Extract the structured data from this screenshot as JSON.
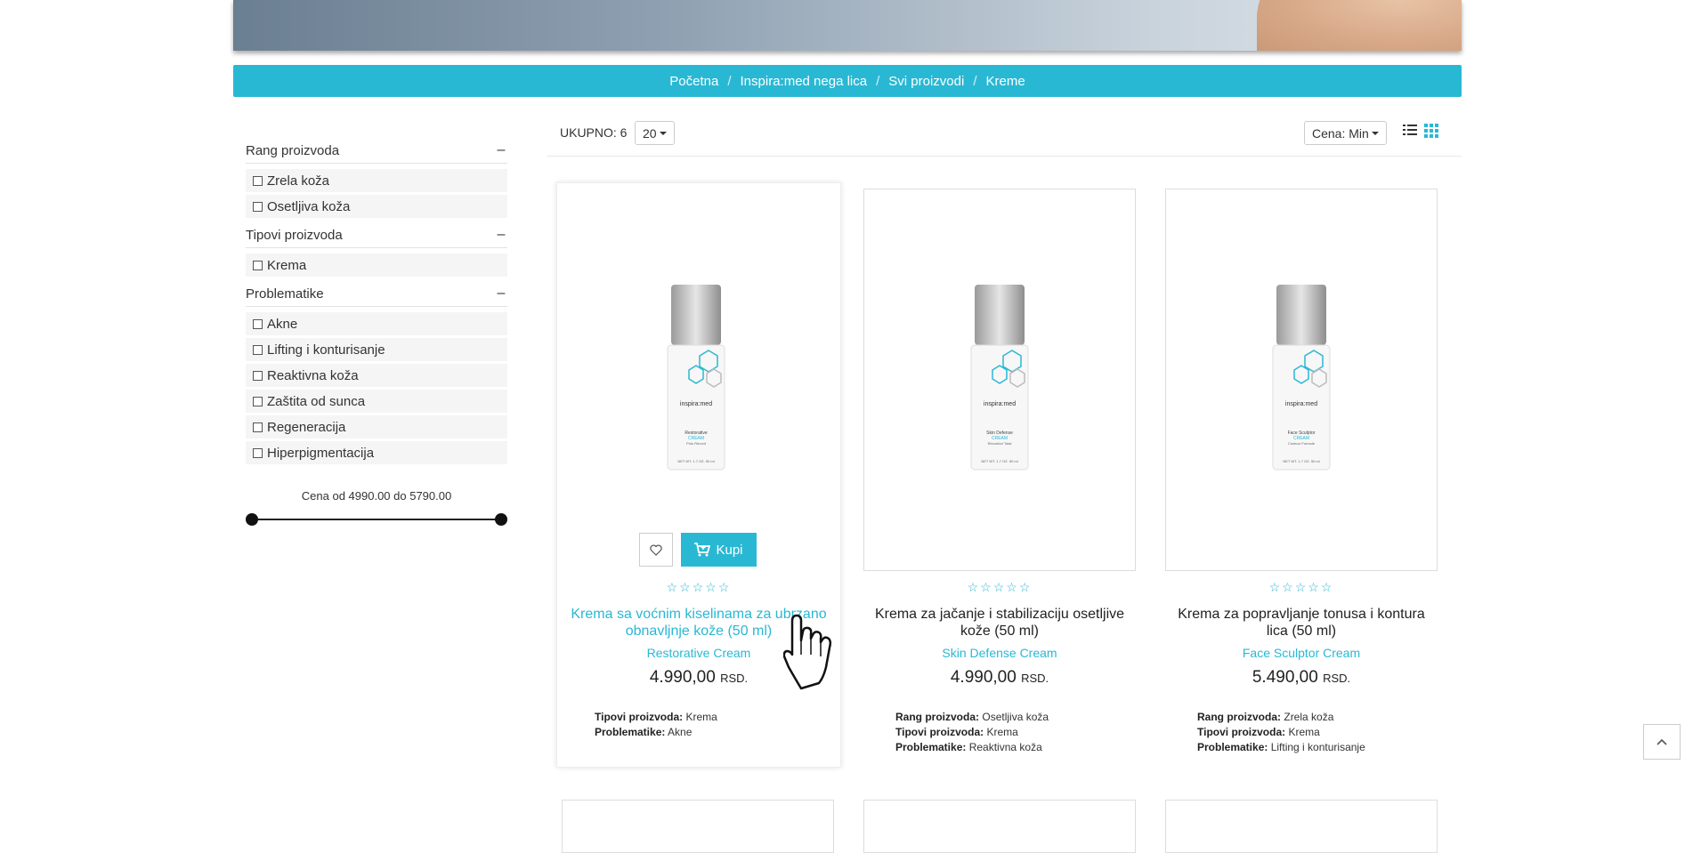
{
  "breadcrumb": [
    "Početna",
    "Inspira:med nega lica",
    "Svi proizvodi",
    "Kreme"
  ],
  "filters": [
    {
      "title": "Rang proizvoda",
      "toggle": "–",
      "options": [
        "Zrela koža",
        "Osetljiva koža"
      ]
    },
    {
      "title": "Tipovi proizvoda",
      "toggle": "–",
      "options": [
        "Krema"
      ]
    },
    {
      "title": "Problematike",
      "toggle": "–",
      "options": [
        "Akne",
        "Lifting i konturisanje",
        "Reaktivna koža",
        "Zaštita od sunca",
        "Regeneracija",
        "Hiperpigmentacija"
      ]
    }
  ],
  "price_filter": {
    "label": "Cena od 4990.00 do 5790.00",
    "min": 4990,
    "max": 5790
  },
  "toolbar": {
    "total": "UKUPNO: 6",
    "per_page": "20",
    "sort": "Cena: Min"
  },
  "buttons": {
    "buy": "Kupi"
  },
  "product_image": {
    "brand": "inspira:med",
    "size": "NET WT. 1.7 OZ.   50 ml"
  },
  "products": [
    {
      "title": "Krema sa voćnim kiselinama za ubrzano obnavljnje kože (50 ml)",
      "subtitle": "Restorative Cream",
      "price": "4.990,00",
      "currency": "RSD.",
      "label_top": "Restorative",
      "label_mid": "CREAM",
      "label_bot": "Polo Réconf",
      "attrs": [
        {
          "k": "Tipovi proizvoda:",
          "v": "Krema"
        },
        {
          "k": "Problematike:",
          "v": "Akne"
        }
      ]
    },
    {
      "title": "Krema za jačanje i stabilizaciju osetljive kože (50 ml)",
      "subtitle": "Skin Defense Cream",
      "price": "4.990,00",
      "currency": "RSD.",
      "label_top": "Skin Defense",
      "label_mid": "CREAM",
      "label_bot": "Réconfort Total",
      "attrs": [
        {
          "k": "Rang proizvoda:",
          "v": "Osetljiva koža"
        },
        {
          "k": "Tipovi proizvoda:",
          "v": "Krema"
        },
        {
          "k": "Problematike:",
          "v": "Reaktivna koža"
        }
      ]
    },
    {
      "title": "Krema za popravljanje tonusa i kontura lica (50 ml)",
      "subtitle": "Face Sculptor Cream",
      "price": "5.490,00",
      "currency": "RSD.",
      "label_top": "Face Sculptor",
      "label_mid": "CREAM",
      "label_bot": "Contour Formule",
      "attrs": [
        {
          "k": "Rang proizvoda:",
          "v": "Zrela koža"
        },
        {
          "k": "Tipovi proizvoda:",
          "v": "Krema"
        },
        {
          "k": "Problematike:",
          "v": "Lifting i konturisanje"
        }
      ]
    }
  ],
  "colors": {
    "accent": "#29b8d4"
  }
}
